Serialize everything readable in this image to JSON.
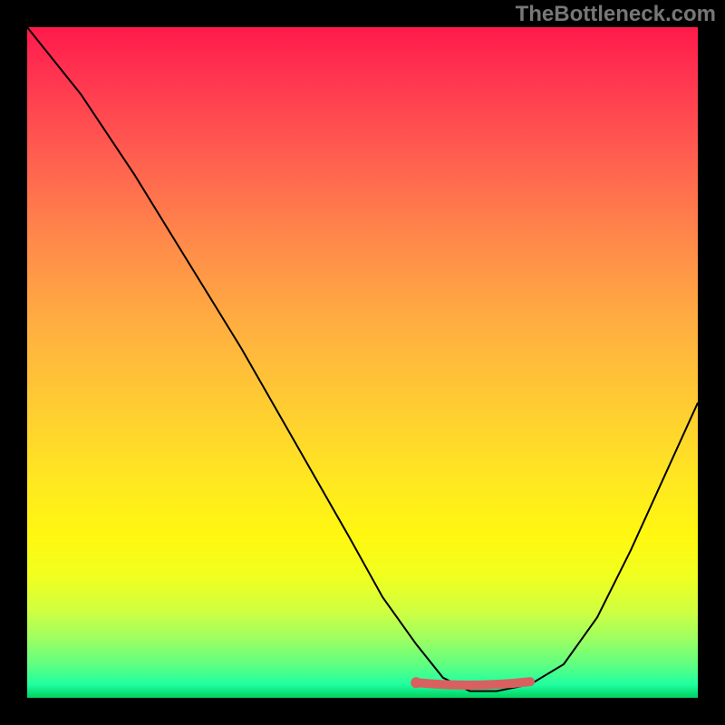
{
  "watermark": "TheBottleneck.com",
  "chart_data": {
    "type": "line",
    "title": "",
    "xlabel": "",
    "ylabel": "",
    "xlim": [
      0,
      100
    ],
    "ylim": [
      0,
      100
    ],
    "series": [
      {
        "name": "curve",
        "x": [
          0,
          8,
          16,
          24,
          32,
          40,
          48,
          53,
          58,
          62,
          66,
          70,
          75,
          80,
          85,
          90,
          95,
          100
        ],
        "y": [
          100,
          90,
          78,
          65,
          52,
          38,
          24,
          15,
          8,
          3,
          1,
          1,
          2,
          5,
          12,
          22,
          33,
          44
        ]
      }
    ],
    "optimal_zone": {
      "x_start": 58,
      "x_end": 75,
      "y": 2
    },
    "background_gradient": {
      "top": "#ff1a4a",
      "mid": "#ffe820",
      "bottom": "#00d060"
    }
  }
}
